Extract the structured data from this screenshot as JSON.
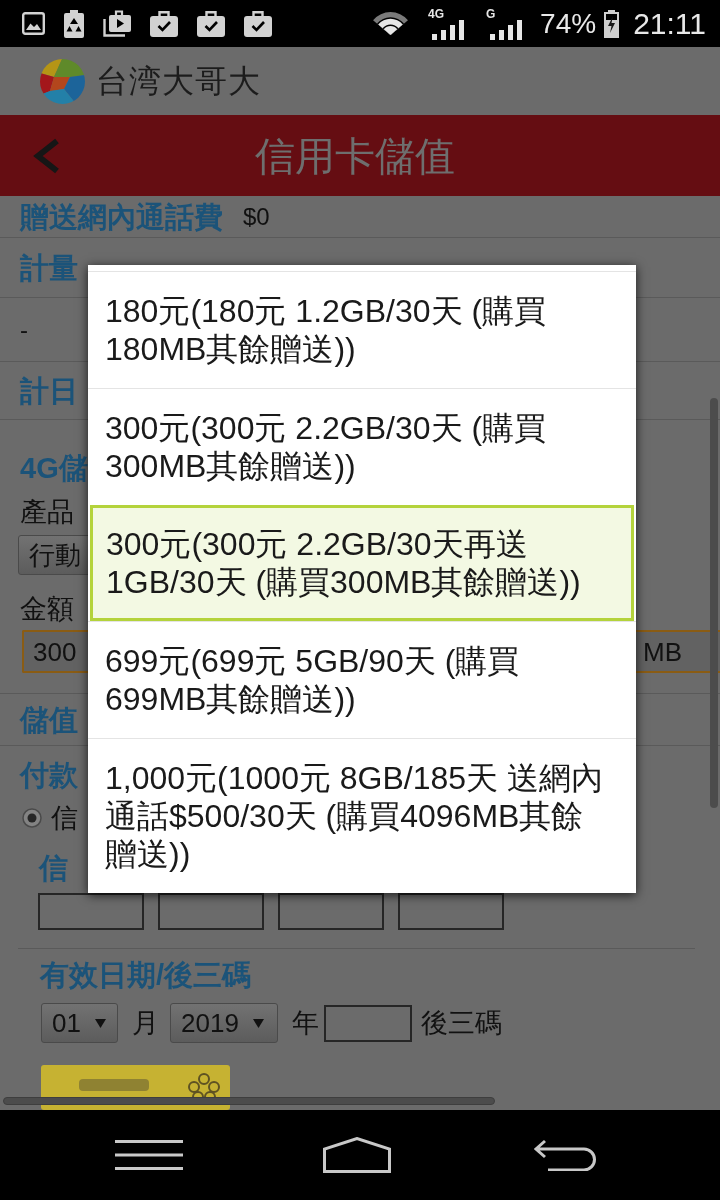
{
  "status_bar": {
    "network_labels": [
      "4G",
      "G"
    ],
    "battery": "74%",
    "time": "21:11"
  },
  "app_header": {
    "brand": "台湾大哥大"
  },
  "title_bar": {
    "title": "信用卡儲值"
  },
  "info_rows": [
    {
      "label": "贈送網內通話費",
      "value": "$0"
    },
    {
      "label": "計量"
    },
    {
      "value": "-"
    },
    {
      "label": "計日"
    }
  ],
  "topup": {
    "heading": "4G儲",
    "product_label": "產品",
    "product_select": "行動",
    "amount_label": "金額",
    "amount_select": {
      "value": "300",
      "value_end": "MB"
    }
  },
  "stored_value": {
    "heading": "儲值"
  },
  "payment": {
    "heading": "付款",
    "options": [
      {
        "label": "信",
        "selected": true
      }
    ],
    "card_number_label": "信"
  },
  "expiry": {
    "heading": "有效日期/後三碼",
    "month": "01",
    "month_unit": "月",
    "year": "2019",
    "year_unit": "年",
    "cvv_label": "後三碼"
  },
  "dialog": {
    "options": [
      {
        "label": "180元(180元 1.2GB/30天 (購買180MB其餘贈送))",
        "selected": false
      },
      {
        "label": "300元(300元 2.2GB/30天 (購買300MB其餘贈送))",
        "selected": false
      },
      {
        "label": "300元(300元 2.2GB/30天再送1GB/30天 (購買300MB其餘贈送))",
        "selected": true
      },
      {
        "label": "699元(699元 5GB/90天 (購買699MB其餘贈送))",
        "selected": false
      },
      {
        "label": "1,000元(1000元 8GB/185天 送網內通話$500/30天 (購買4096MB其餘贈送))",
        "selected": false
      }
    ]
  }
}
